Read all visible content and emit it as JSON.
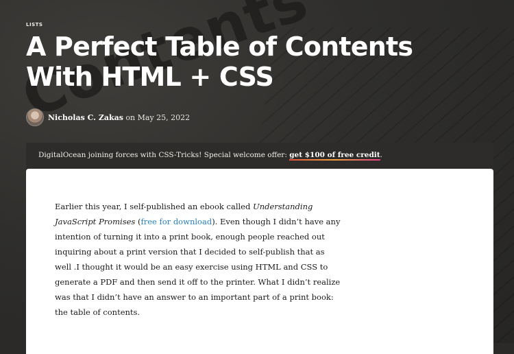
{
  "hero": {
    "category": "LISTS",
    "title": "A Perfect Table of Contents With HTML + CSS",
    "decorative_word": "Contents",
    "author": "Nicholas C. Zakas",
    "date_prefix": "on",
    "date": "May 25, 2022"
  },
  "banner": {
    "text": "DigitalOcean joining forces with CSS-Tricks! Special welcome offer: ",
    "link": "get $100 of free credit",
    "suffix": "."
  },
  "article": {
    "p1": "Earlier this year, I self-published an ebook called ",
    "book_title": "Understanding JavaScript Promises",
    "p2": " (",
    "link": "free for download",
    "p3": "). Even though I didn’t have any intention of turning it into a print book, enough people reached out inquiring about a print version that I decided to self-publish that as well .I thought it would be an easy exercise using HTML and CSS to generate a PDF and then send it off to the printer. What I didn’t realize was that I didn’t have an answer to an important part of a print book: the table of contents."
  },
  "colors": {
    "background": "#2b2a28",
    "link": "#2980b9",
    "card": "#ffffff"
  },
  "icons": {
    "avatar": "author-avatar"
  }
}
